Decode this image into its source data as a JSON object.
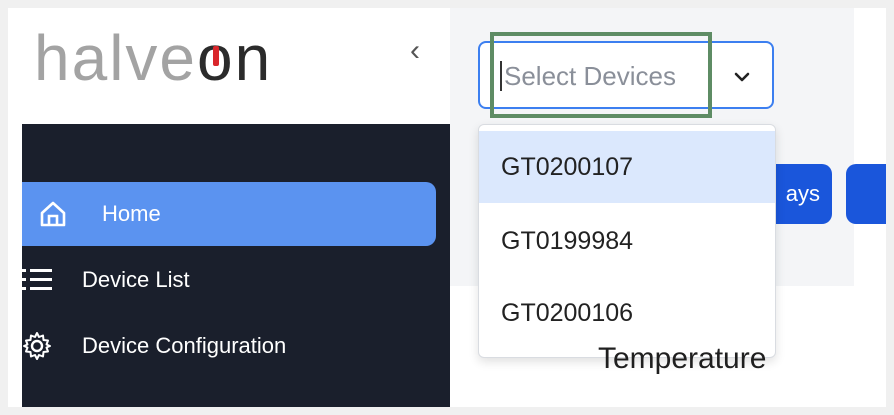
{
  "logo": {
    "part1": "halve",
    "part2": "o",
    "part3": "n"
  },
  "sidebar": {
    "collapse_glyph": "‹",
    "items": [
      {
        "label": "Home",
        "icon": "home-icon"
      },
      {
        "label": "Device List",
        "icon": "list-icon"
      },
      {
        "label": "Device Configuration",
        "icon": "gear-icon"
      }
    ]
  },
  "device_select": {
    "placeholder": "Select Devices",
    "options": [
      "GT0200107",
      "GT0199984",
      "GT0200106"
    ]
  },
  "toolbar": {
    "days_button_partial": "ays"
  },
  "main": {
    "temperature_title": "Temperature"
  },
  "colors": {
    "sidebar_bg": "#1a1f2c",
    "active_item": "#5b93f0",
    "primary_button": "#1a56db",
    "select_border": "#3c7ff0",
    "highlight_box": "#5e8c64",
    "logo_red": "#d9262b"
  }
}
